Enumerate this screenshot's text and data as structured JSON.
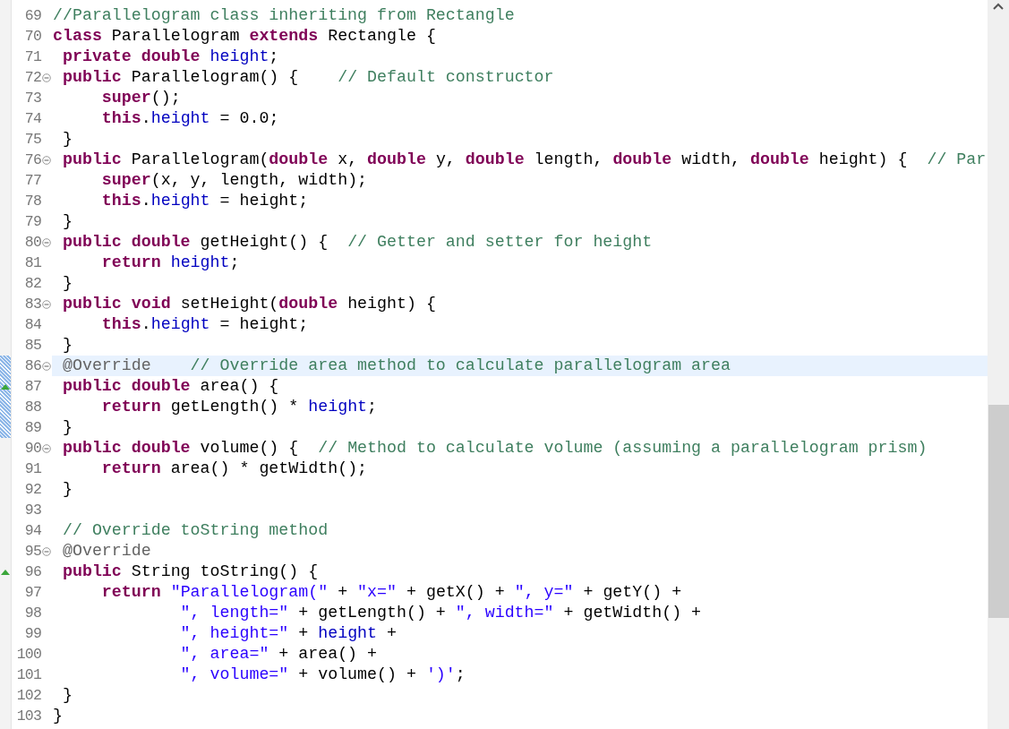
{
  "lines": [
    {
      "number": "69",
      "foldable": false,
      "override": false,
      "changed": false,
      "current": false,
      "tokens": [
        {
          "kind": "comment",
          "text": "//Parallelogram class inheriting from Rectangle"
        }
      ]
    },
    {
      "number": "70",
      "foldable": false,
      "override": false,
      "changed": false,
      "current": false,
      "tokens": [
        {
          "kind": "keyword",
          "text": "class"
        },
        {
          "kind": "plain",
          "text": " Parallelogram "
        },
        {
          "kind": "keyword",
          "text": "extends"
        },
        {
          "kind": "plain",
          "text": " Rectangle {"
        }
      ]
    },
    {
      "number": "71",
      "foldable": false,
      "override": false,
      "changed": false,
      "current": false,
      "tokens": [
        {
          "kind": "keyword",
          "text": " private"
        },
        {
          "kind": "keyword",
          "text": " double"
        },
        {
          "kind": "field",
          "text": " height"
        },
        {
          "kind": "plain",
          "text": ";"
        }
      ]
    },
    {
      "number": "72",
      "foldable": true,
      "override": false,
      "changed": false,
      "current": false,
      "tokens": [
        {
          "kind": "keyword",
          "text": " public"
        },
        {
          "kind": "plain",
          "text": " Parallelogram() {    "
        },
        {
          "kind": "comment",
          "text": "// Default constructor"
        }
      ]
    },
    {
      "number": "73",
      "foldable": false,
      "override": false,
      "changed": false,
      "current": false,
      "tokens": [
        {
          "kind": "keyword",
          "text": "     super"
        },
        {
          "kind": "plain",
          "text": "();"
        }
      ]
    },
    {
      "number": "74",
      "foldable": false,
      "override": false,
      "changed": false,
      "current": false,
      "tokens": [
        {
          "kind": "keyword",
          "text": "     this"
        },
        {
          "kind": "plain",
          "text": "."
        },
        {
          "kind": "field",
          "text": "height"
        },
        {
          "kind": "plain",
          "text": " = 0.0;"
        }
      ]
    },
    {
      "number": "75",
      "foldable": false,
      "override": false,
      "changed": false,
      "current": false,
      "tokens": [
        {
          "kind": "plain",
          "text": " }"
        }
      ]
    },
    {
      "number": "76",
      "foldable": true,
      "override": false,
      "changed": false,
      "current": false,
      "tokens": [
        {
          "kind": "keyword",
          "text": " public"
        },
        {
          "kind": "plain",
          "text": " Parallelogram("
        },
        {
          "kind": "keyword",
          "text": "double"
        },
        {
          "kind": "plain",
          "text": " x, "
        },
        {
          "kind": "keyword",
          "text": "double"
        },
        {
          "kind": "plain",
          "text": " y, "
        },
        {
          "kind": "keyword",
          "text": "double"
        },
        {
          "kind": "plain",
          "text": " length, "
        },
        {
          "kind": "keyword",
          "text": "double"
        },
        {
          "kind": "plain",
          "text": " width, "
        },
        {
          "kind": "keyword",
          "text": "double"
        },
        {
          "kind": "plain",
          "text": " height) {  "
        },
        {
          "kind": "comment",
          "text": "// Par"
        }
      ]
    },
    {
      "number": "77",
      "foldable": false,
      "override": false,
      "changed": false,
      "current": false,
      "tokens": [
        {
          "kind": "keyword",
          "text": "     super"
        },
        {
          "kind": "plain",
          "text": "(x, y, length, width);"
        }
      ]
    },
    {
      "number": "78",
      "foldable": false,
      "override": false,
      "changed": false,
      "current": false,
      "tokens": [
        {
          "kind": "keyword",
          "text": "     this"
        },
        {
          "kind": "plain",
          "text": "."
        },
        {
          "kind": "field",
          "text": "height"
        },
        {
          "kind": "plain",
          "text": " = height;"
        }
      ]
    },
    {
      "number": "79",
      "foldable": false,
      "override": false,
      "changed": false,
      "current": false,
      "tokens": [
        {
          "kind": "plain",
          "text": " }"
        }
      ]
    },
    {
      "number": "80",
      "foldable": true,
      "override": false,
      "changed": false,
      "current": false,
      "tokens": [
        {
          "kind": "keyword",
          "text": " public"
        },
        {
          "kind": "keyword",
          "text": " double"
        },
        {
          "kind": "plain",
          "text": " getHeight() {  "
        },
        {
          "kind": "comment",
          "text": "// Getter and setter for height"
        }
      ]
    },
    {
      "number": "81",
      "foldable": false,
      "override": false,
      "changed": false,
      "current": false,
      "tokens": [
        {
          "kind": "keyword",
          "text": "     return"
        },
        {
          "kind": "field",
          "text": " height"
        },
        {
          "kind": "plain",
          "text": ";"
        }
      ]
    },
    {
      "number": "82",
      "foldable": false,
      "override": false,
      "changed": false,
      "current": false,
      "tokens": [
        {
          "kind": "plain",
          "text": " }"
        }
      ]
    },
    {
      "number": "83",
      "foldable": true,
      "override": false,
      "changed": false,
      "current": false,
      "tokens": [
        {
          "kind": "keyword",
          "text": " public"
        },
        {
          "kind": "keyword",
          "text": " void"
        },
        {
          "kind": "plain",
          "text": " setHeight("
        },
        {
          "kind": "keyword",
          "text": "double"
        },
        {
          "kind": "plain",
          "text": " height) {"
        }
      ]
    },
    {
      "number": "84",
      "foldable": false,
      "override": false,
      "changed": false,
      "current": false,
      "tokens": [
        {
          "kind": "keyword",
          "text": "     this"
        },
        {
          "kind": "plain",
          "text": "."
        },
        {
          "kind": "field",
          "text": "height"
        },
        {
          "kind": "plain",
          "text": " = height;"
        }
      ]
    },
    {
      "number": "85",
      "foldable": false,
      "override": false,
      "changed": false,
      "current": false,
      "tokens": [
        {
          "kind": "plain",
          "text": " }"
        }
      ]
    },
    {
      "number": "86",
      "foldable": true,
      "override": false,
      "changed": true,
      "current": true,
      "tokens": [
        {
          "kind": "annotation",
          "text": " @Override"
        },
        {
          "kind": "comment",
          "text": "    // Override area method to calculate parallelogram area"
        }
      ]
    },
    {
      "number": "87",
      "foldable": false,
      "override": true,
      "changed": true,
      "current": false,
      "tokens": [
        {
          "kind": "keyword",
          "text": " public"
        },
        {
          "kind": "keyword",
          "text": " double"
        },
        {
          "kind": "plain",
          "text": " area() {"
        }
      ]
    },
    {
      "number": "88",
      "foldable": false,
      "override": false,
      "changed": true,
      "current": false,
      "tokens": [
        {
          "kind": "keyword",
          "text": "     return"
        },
        {
          "kind": "plain",
          "text": " getLength() * "
        },
        {
          "kind": "field",
          "text": "height"
        },
        {
          "kind": "plain",
          "text": ";"
        }
      ]
    },
    {
      "number": "89",
      "foldable": false,
      "override": false,
      "changed": true,
      "current": false,
      "tokens": [
        {
          "kind": "plain",
          "text": " }"
        }
      ]
    },
    {
      "number": "90",
      "foldable": true,
      "override": false,
      "changed": false,
      "current": false,
      "tokens": [
        {
          "kind": "keyword",
          "text": " public"
        },
        {
          "kind": "keyword",
          "text": " double"
        },
        {
          "kind": "plain",
          "text": " volume() {  "
        },
        {
          "kind": "comment",
          "text": "// Method to calculate volume (assuming a parallelogram prism)"
        }
      ]
    },
    {
      "number": "91",
      "foldable": false,
      "override": false,
      "changed": false,
      "current": false,
      "tokens": [
        {
          "kind": "keyword",
          "text": "     return"
        },
        {
          "kind": "plain",
          "text": " area() * getWidth();"
        }
      ]
    },
    {
      "number": "92",
      "foldable": false,
      "override": false,
      "changed": false,
      "current": false,
      "tokens": [
        {
          "kind": "plain",
          "text": " }"
        }
      ]
    },
    {
      "number": "93",
      "foldable": false,
      "override": false,
      "changed": false,
      "current": false
    },
    {
      "number": "94",
      "foldable": false,
      "override": false,
      "changed": false,
      "current": false,
      "tokens": [
        {
          "kind": "comment",
          "text": " // Override toString method"
        }
      ]
    },
    {
      "number": "95",
      "foldable": true,
      "override": false,
      "changed": false,
      "current": false,
      "tokens": [
        {
          "kind": "annotation",
          "text": " @Override"
        }
      ]
    },
    {
      "number": "96",
      "foldable": false,
      "override": true,
      "changed": false,
      "current": false,
      "tokens": [
        {
          "kind": "keyword",
          "text": " public"
        },
        {
          "kind": "plain",
          "text": " String toString() {"
        }
      ]
    },
    {
      "number": "97",
      "foldable": false,
      "override": false,
      "changed": false,
      "current": false,
      "tokens": [
        {
          "kind": "keyword",
          "text": "     return"
        },
        {
          "kind": "string",
          "text": " \"Parallelogram(\""
        },
        {
          "kind": "plain",
          "text": " + "
        },
        {
          "kind": "string",
          "text": "\"x=\""
        },
        {
          "kind": "plain",
          "text": " + getX() + "
        },
        {
          "kind": "string",
          "text": "\", y=\""
        },
        {
          "kind": "plain",
          "text": " + getY() +"
        }
      ]
    },
    {
      "number": "98",
      "foldable": false,
      "override": false,
      "changed": false,
      "current": false,
      "tokens": [
        {
          "kind": "string",
          "text": "             \", length=\""
        },
        {
          "kind": "plain",
          "text": " + getLength() + "
        },
        {
          "kind": "string",
          "text": "\", width=\""
        },
        {
          "kind": "plain",
          "text": " + getWidth() +"
        }
      ]
    },
    {
      "number": "99",
      "foldable": false,
      "override": false,
      "changed": false,
      "current": false,
      "tokens": [
        {
          "kind": "string",
          "text": "             \", height=\""
        },
        {
          "kind": "plain",
          "text": " + "
        },
        {
          "kind": "field",
          "text": "height"
        },
        {
          "kind": "plain",
          "text": " +"
        }
      ]
    },
    {
      "number": "100",
      "foldable": false,
      "override": false,
      "changed": false,
      "current": false,
      "tokens": [
        {
          "kind": "string",
          "text": "             \", area=\""
        },
        {
          "kind": "plain",
          "text": " + area() +"
        }
      ]
    },
    {
      "number": "101",
      "foldable": false,
      "override": false,
      "changed": false,
      "current": false,
      "tokens": [
        {
          "kind": "string",
          "text": "             \", volume=\""
        },
        {
          "kind": "plain",
          "text": " + volume() + "
        },
        {
          "kind": "string",
          "text": "')'"
        },
        {
          "kind": "plain",
          "text": ";"
        }
      ]
    },
    {
      "number": "102",
      "foldable": false,
      "override": false,
      "changed": false,
      "current": false,
      "tokens": [
        {
          "kind": "plain",
          "text": " }"
        }
      ]
    },
    {
      "number": "103",
      "foldable": false,
      "override": false,
      "changed": false,
      "current": false,
      "tokens": [
        {
          "kind": "plain",
          "text": "}"
        }
      ]
    }
  ]
}
